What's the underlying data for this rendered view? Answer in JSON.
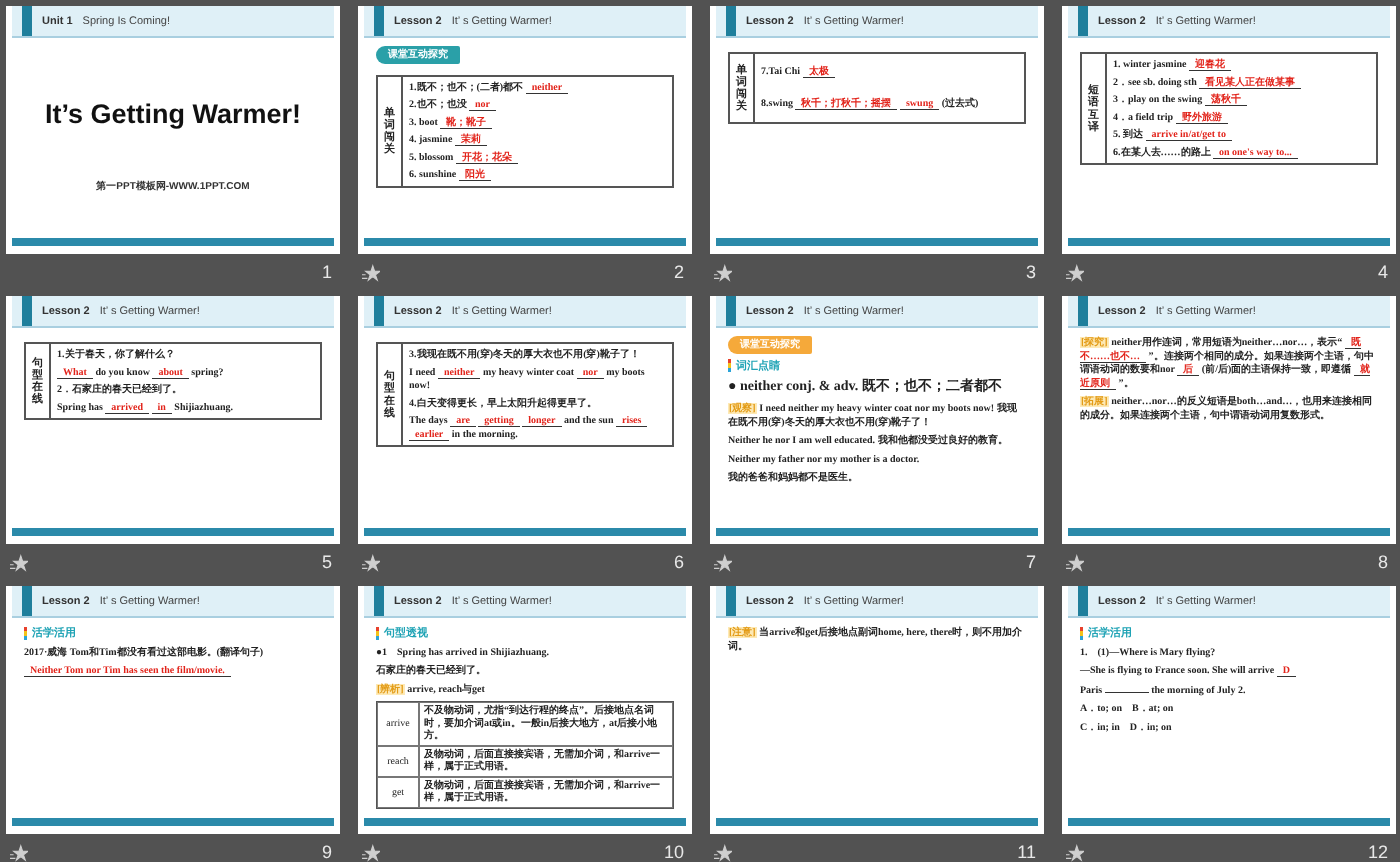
{
  "slides": [
    {
      "number": "1",
      "animated": false,
      "header": {
        "label": "Unit 1",
        "title": "Spring Is Coming!"
      },
      "blocks": [
        {
          "kind": "title",
          "text": "It’s  Getting Warmer!"
        },
        {
          "kind": "site",
          "text": "第一PPT模板网-WWW.1PPT.COM"
        }
      ]
    },
    {
      "number": "2",
      "animated": true,
      "header": {
        "label": "Lesson 2",
        "title": "It’ s Getting Warmer!"
      },
      "blocks": [
        {
          "kind": "badge",
          "text": "课堂互动探究",
          "color": "#2aa0a8"
        },
        {
          "kind": "side-table",
          "side": "单词闯关",
          "lines": [
            {
              "segments": [
                {
                  "kind": "text",
                  "text": "1.既不；也不；(二者)都不"
                },
                {
                  "kind": "answer",
                  "text": "neither"
                }
              ]
            },
            {
              "segments": [
                {
                  "kind": "text",
                  "text": "2.也不；也没"
                },
                {
                  "kind": "answer",
                  "text": "nor"
                }
              ]
            },
            {
              "segments": [
                {
                  "kind": "text",
                  "text": "3. boot"
                },
                {
                  "kind": "answer",
                  "text": "靴；靴子"
                }
              ]
            },
            {
              "segments": [
                {
                  "kind": "text",
                  "text": "4. jasmine"
                },
                {
                  "kind": "answer",
                  "text": "茉莉"
                }
              ]
            },
            {
              "segments": [
                {
                  "kind": "text",
                  "text": "5. blossom"
                },
                {
                  "kind": "answer",
                  "text": "开花；花朵"
                }
              ]
            },
            {
              "segments": [
                {
                  "kind": "text",
                  "text": "6. sunshine"
                },
                {
                  "kind": "answer",
                  "text": "阳光"
                }
              ]
            }
          ]
        }
      ]
    },
    {
      "number": "3",
      "animated": true,
      "header": {
        "label": "Lesson 2",
        "title": "It’ s Getting Warmer!"
      },
      "blocks": [
        {
          "kind": "side-table",
          "side": "单词闯关",
          "lines": [
            {
              "segments": [
                {
                  "kind": "text",
                  "text": "7.Tai Chi"
                },
                {
                  "kind": "answer",
                  "text": "太极"
                }
              ]
            },
            {
              "segments": [
                {
                  "kind": "text",
                  "text": "8.swing"
                },
                {
                  "kind": "answer",
                  "text": "秋千；打秋千；摇摆"
                },
                {
                  "kind": "answer",
                  "text": "swung"
                },
                {
                  "kind": "text",
                  "text": "(过去式)"
                }
              ]
            }
          ]
        }
      ]
    },
    {
      "number": "4",
      "animated": true,
      "header": {
        "label": "Lesson 2",
        "title": "It’ s Getting Warmer!"
      },
      "blocks": [
        {
          "kind": "side-table",
          "side": "短语互译",
          "lines": [
            {
              "segments": [
                {
                  "kind": "text",
                  "text": "1. winter jasmine"
                },
                {
                  "kind": "answer",
                  "text": "迎春花"
                }
              ]
            },
            {
              "segments": [
                {
                  "kind": "text",
                  "text": "2．see sb. doing sth"
                },
                {
                  "kind": "answer",
                  "text": "看见某人正在做某事"
                }
              ]
            },
            {
              "segments": [
                {
                  "kind": "text",
                  "text": "3．play on the swing"
                },
                {
                  "kind": "answer",
                  "text": "荡秋千"
                }
              ]
            },
            {
              "segments": [
                {
                  "kind": "text",
                  "text": "4．a field trip"
                },
                {
                  "kind": "answer",
                  "text": "野外旅游"
                }
              ]
            },
            {
              "segments": [
                {
                  "kind": "text",
                  "text": "5. 到达"
                },
                {
                  "kind": "answer",
                  "text": "arrive in/at/get to"
                }
              ]
            },
            {
              "segments": [
                {
                  "kind": "text",
                  "text": "6.在某人去……的路上"
                },
                {
                  "kind": "answer",
                  "text": "on one's way to..."
                }
              ]
            }
          ]
        }
      ]
    },
    {
      "number": "5",
      "animated": true,
      "header": {
        "label": "Lesson 2",
        "title": "It’ s Getting Warmer!"
      },
      "blocks": [
        {
          "kind": "side-table",
          "side": "句型在线",
          "lines": [
            {
              "segments": [
                {
                  "kind": "text",
                  "text": "1.关于春天，你了解什么？"
                }
              ]
            },
            {
              "segments": [
                {
                  "kind": "answer",
                  "text": "What"
                },
                {
                  "kind": "text",
                  "text": "do you know"
                },
                {
                  "kind": "answer",
                  "text": "about"
                },
                {
                  "kind": "text",
                  "text": "spring?"
                }
              ]
            },
            {
              "segments": [
                {
                  "kind": "text",
                  "text": "2．石家庄的春天已经到了。"
                }
              ]
            },
            {
              "segments": [
                {
                  "kind": "text",
                  "text": "Spring has"
                },
                {
                  "kind": "answer",
                  "text": "arrived"
                },
                {
                  "kind": "answer",
                  "text": "in"
                },
                {
                  "kind": "text",
                  "text": "Shijiazhuang."
                }
              ]
            }
          ]
        }
      ]
    },
    {
      "number": "6",
      "animated": true,
      "header": {
        "label": "Lesson 2",
        "title": "It’ s Getting Warmer!"
      },
      "blocks": [
        {
          "kind": "side-table",
          "side": "句型在线",
          "lines": [
            {
              "segments": [
                {
                  "kind": "text",
                  "text": "3.我现在既不用(穿)冬天的厚大衣也不用(穿)靴子了！"
                }
              ]
            },
            {
              "segments": [
                {
                  "kind": "text",
                  "text": "I need"
                },
                {
                  "kind": "answer",
                  "text": "neither"
                },
                {
                  "kind": "text",
                  "text": "my heavy winter coat"
                },
                {
                  "kind": "answer",
                  "text": "nor"
                },
                {
                  "kind": "text",
                  "text": "my boots now!"
                }
              ]
            },
            {
              "segments": [
                {
                  "kind": "text",
                  "text": "4.白天变得更长，早上太阳升起得更早了。"
                }
              ]
            },
            {
              "segments": [
                {
                  "kind": "text",
                  "text": "The days"
                },
                {
                  "kind": "answer",
                  "text": "are"
                },
                {
                  "kind": "answer",
                  "text": "getting"
                },
                {
                  "kind": "answer",
                  "text": "longer"
                },
                {
                  "kind": "text",
                  "text": "and the sun"
                },
                {
                  "kind": "answer",
                  "text": "rises"
                },
                {
                  "kind": "answer",
                  "text": "earlier"
                },
                {
                  "kind": "text",
                  "text": "in the morning."
                }
              ]
            }
          ]
        }
      ]
    },
    {
      "number": "7",
      "animated": true,
      "header": {
        "label": "Lesson 2",
        "title": "It’ s Getting Warmer!"
      },
      "blocks": [
        {
          "kind": "badge",
          "text": "课堂互动探究",
          "color": "#f5a93a"
        },
        {
          "kind": "heading",
          "text": "词汇点睛"
        },
        {
          "kind": "lead",
          "text": "● neither conj. & adv. 既不；也不；二者都不"
        },
        {
          "kind": "para",
          "segments": [
            {
              "kind": "tag",
              "text": "[观察]"
            },
            {
              "kind": "text",
              "text": "I need neither my heavy winter coat nor my boots now! 我现在既不用(穿)冬天的厚大衣也不用(穿)靴子了！"
            }
          ]
        },
        {
          "kind": "para",
          "segments": [
            {
              "kind": "text",
              "text": "Neither he nor I am well educated. 我和他都没受过良好的教育。"
            }
          ]
        },
        {
          "kind": "para",
          "segments": [
            {
              "kind": "text",
              "text": "Neither my father nor my mother is a doctor."
            }
          ]
        },
        {
          "kind": "para",
          "segments": [
            {
              "kind": "text",
              "text": "我的爸爸和妈妈都不是医生。"
            }
          ]
        }
      ]
    },
    {
      "number": "8",
      "animated": true,
      "header": {
        "label": "Lesson 2",
        "title": "It’ s Getting Warmer!"
      },
      "blocks": [
        {
          "kind": "para",
          "segments": [
            {
              "kind": "tag",
              "text": "[探究]"
            },
            {
              "kind": "text",
              "text": "neither用作连词，常用短语为neither…nor…，表示“"
            },
            {
              "kind": "answer",
              "text": "既不……也不…"
            },
            {
              "kind": "text",
              "text": "”。连接两个相同的成分。如果连接两个主语，句中谓语动词的数要和nor"
            },
            {
              "kind": "answer",
              "text": "后"
            },
            {
              "kind": "text",
              "text": "(前/后)面的主语保持一致，即遵循"
            },
            {
              "kind": "answer",
              "text": "就近原则"
            },
            {
              "kind": "text",
              "text": "”。"
            }
          ]
        },
        {
          "kind": "para",
          "segments": [
            {
              "kind": "tag",
              "text": "[拓展]"
            },
            {
              "kind": "text",
              "text": "neither…nor…的反义短语是both…and…，也用来连接相同的成分。如果连接两个主语，句中谓语动词用复数形式。"
            }
          ]
        }
      ]
    },
    {
      "number": "9",
      "animated": true,
      "header": {
        "label": "Lesson 2",
        "title": "It’ s Getting Warmer!"
      },
      "blocks": [
        {
          "kind": "heading",
          "text": "活学活用"
        },
        {
          "kind": "para",
          "segments": [
            {
              "kind": "text",
              "text": "2017·威海 Tom和Tim都没有看过这部电影。(翻译句子)"
            }
          ]
        },
        {
          "kind": "para",
          "segments": [
            {
              "kind": "answer",
              "text": "Neither Tom nor Tim has seen the film/movie."
            }
          ]
        }
      ]
    },
    {
      "number": "10",
      "animated": true,
      "header": {
        "label": "Lesson 2",
        "title": "It’ s Getting Warmer!"
      },
      "blocks": [
        {
          "kind": "heading",
          "text": "句型透视"
        },
        {
          "kind": "para",
          "segments": [
            {
              "kind": "text",
              "text": "●1　Spring has arrived in Shijiazhuang."
            }
          ]
        },
        {
          "kind": "para",
          "segments": [
            {
              "kind": "text",
              "text": "石家庄的春天已经到了。"
            }
          ]
        },
        {
          "kind": "para",
          "segments": [
            {
              "kind": "tag",
              "text": "[辨析]"
            },
            {
              "kind": "text",
              "text": "arrive, reach与get"
            }
          ]
        },
        {
          "kind": "grid",
          "rows": [
            {
              "head": "arrive",
              "text": "不及物动词，尤指“到达行程的终点”。后接地点名词时，要加介词at或in。一般in后接大地方，at后接小地方。"
            },
            {
              "head": "reach",
              "text": "及物动词，后面直接接宾语，无需加介词，和arrive一样，属于正式用语。"
            },
            {
              "head": "get",
              "text": "及物动词，后面直接接宾语，无需加介词，和arrive一样，属于正式用语。"
            }
          ]
        }
      ]
    },
    {
      "number": "11",
      "animated": true,
      "header": {
        "label": "Lesson 2",
        "title": "It’ s Getting Warmer!"
      },
      "blocks": [
        {
          "kind": "para",
          "segments": [
            {
              "kind": "tag",
              "text": "[注意]"
            },
            {
              "kind": "text",
              "text": "当arrive和get后接地点副词home, here, there时，则不用加介词。"
            }
          ]
        }
      ]
    },
    {
      "number": "12",
      "animated": true,
      "header": {
        "label": "Lesson 2",
        "title": "It’ s Getting Warmer!"
      },
      "blocks": [
        {
          "kind": "heading",
          "text": "活学活用"
        },
        {
          "kind": "para",
          "segments": [
            {
              "kind": "text",
              "text": "1.　(1)—Where is Mary flying?"
            }
          ]
        },
        {
          "kind": "para",
          "segments": [
            {
              "kind": "text",
              "text": "—She is flying to France soon. She will arrive"
            },
            {
              "kind": "answer",
              "text": "D"
            }
          ]
        },
        {
          "kind": "para",
          "segments": [
            {
              "kind": "text",
              "text": "Paris"
            },
            {
              "kind": "blank"
            },
            {
              "kind": "text",
              "text": "the morning of July 2."
            }
          ]
        },
        {
          "kind": "para",
          "segments": [
            {
              "kind": "text",
              "text": "A．to; on　B．at; on"
            }
          ]
        },
        {
          "kind": "para",
          "segments": [
            {
              "kind": "text",
              "text": "C．in; in　D．in; on"
            }
          ]
        }
      ]
    }
  ]
}
